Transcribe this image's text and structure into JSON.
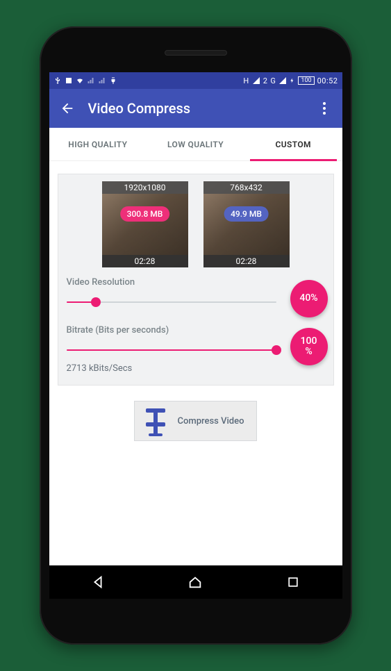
{
  "statusbar": {
    "battery": "100",
    "time": "00:52"
  },
  "appbar": {
    "title": "Video Compress"
  },
  "tabs": {
    "high": "HIGH QUALITY",
    "low": "LOW QUALITY",
    "custom": "CUSTOM"
  },
  "thumbs": {
    "original": {
      "resolution": "1920x1080",
      "size": "300.8 MB",
      "duration": "02:28"
    },
    "output": {
      "resolution": "768x432",
      "size": "49.9 MB",
      "duration": "02:28"
    }
  },
  "resolution": {
    "label": "Video Resolution",
    "percent": "40%",
    "slider_pct": 14
  },
  "bitrate": {
    "label": "Bitrate (Bits per seconds)",
    "percent": "100%",
    "value_line": "2713 kBits/Secs",
    "slider_pct": 100
  },
  "compress": {
    "label": "Compress Video"
  },
  "colors": {
    "accent": "#ec1c73",
    "primary": "#3f51b5"
  }
}
